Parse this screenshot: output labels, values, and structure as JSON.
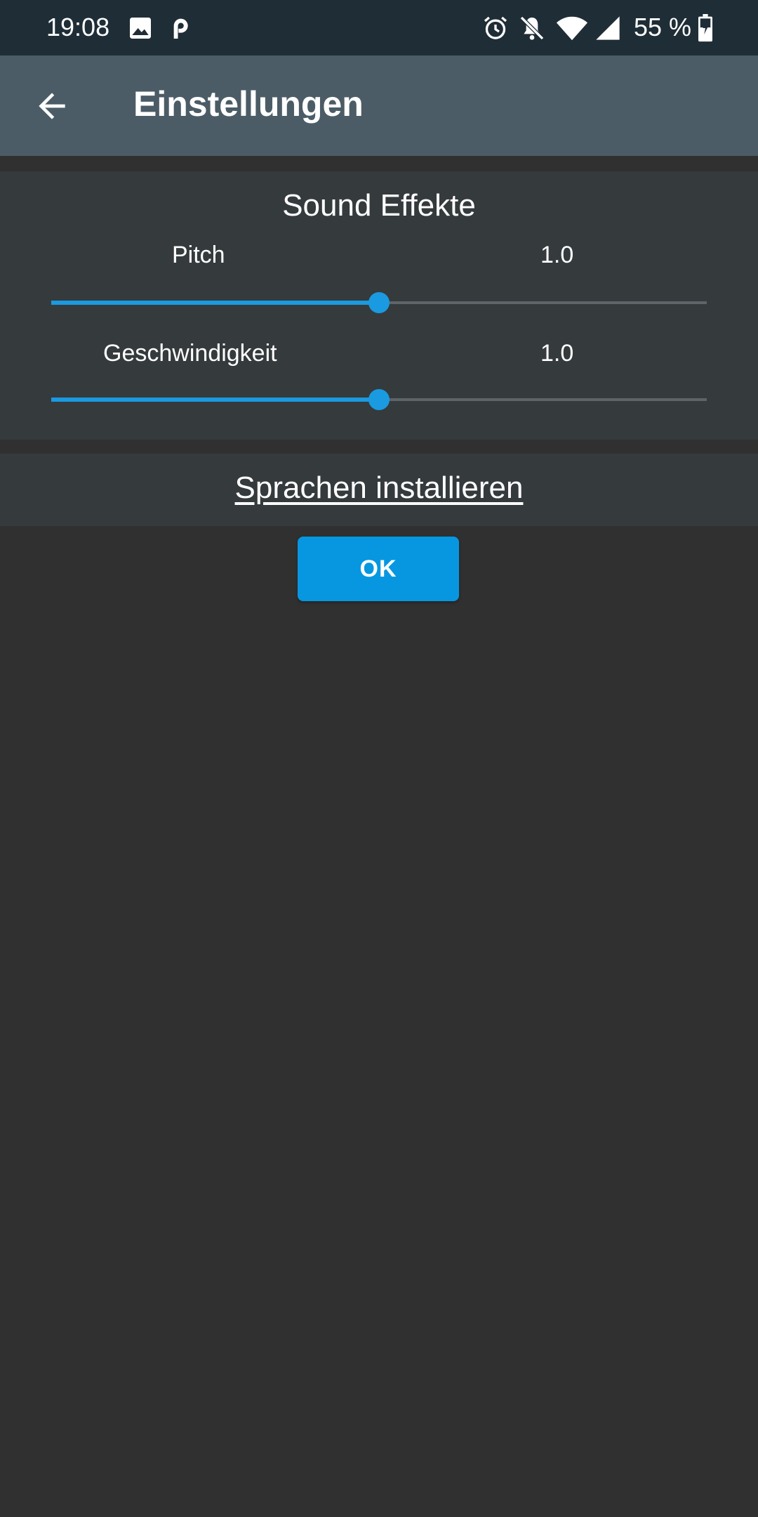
{
  "status_bar": {
    "time": "19:08",
    "icons": [
      "image-icon",
      "pocket-casts-icon",
      "alarm-icon",
      "bell-off-icon",
      "wifi-icon",
      "signal-icon",
      "battery-icon"
    ],
    "battery_percent": "55 %"
  },
  "app_bar": {
    "title": "Einstellungen",
    "back_icon": "arrow-back-icon"
  },
  "sound_effects": {
    "title": "Sound Effekte",
    "pitch": {
      "label": "Pitch",
      "value": "1.0",
      "position_fraction": 0.5
    },
    "speed": {
      "label": "Geschwindigkeit",
      "value": "1.0",
      "position_fraction": 0.5
    }
  },
  "install_languages_label": "Sprachen installieren",
  "ok_label": "OK",
  "colors": {
    "accent": "#1a9ae0",
    "app_bar": "#4b5c66",
    "status_bar": "#1f2d36",
    "background": "#303030",
    "card": "#353a3d"
  }
}
